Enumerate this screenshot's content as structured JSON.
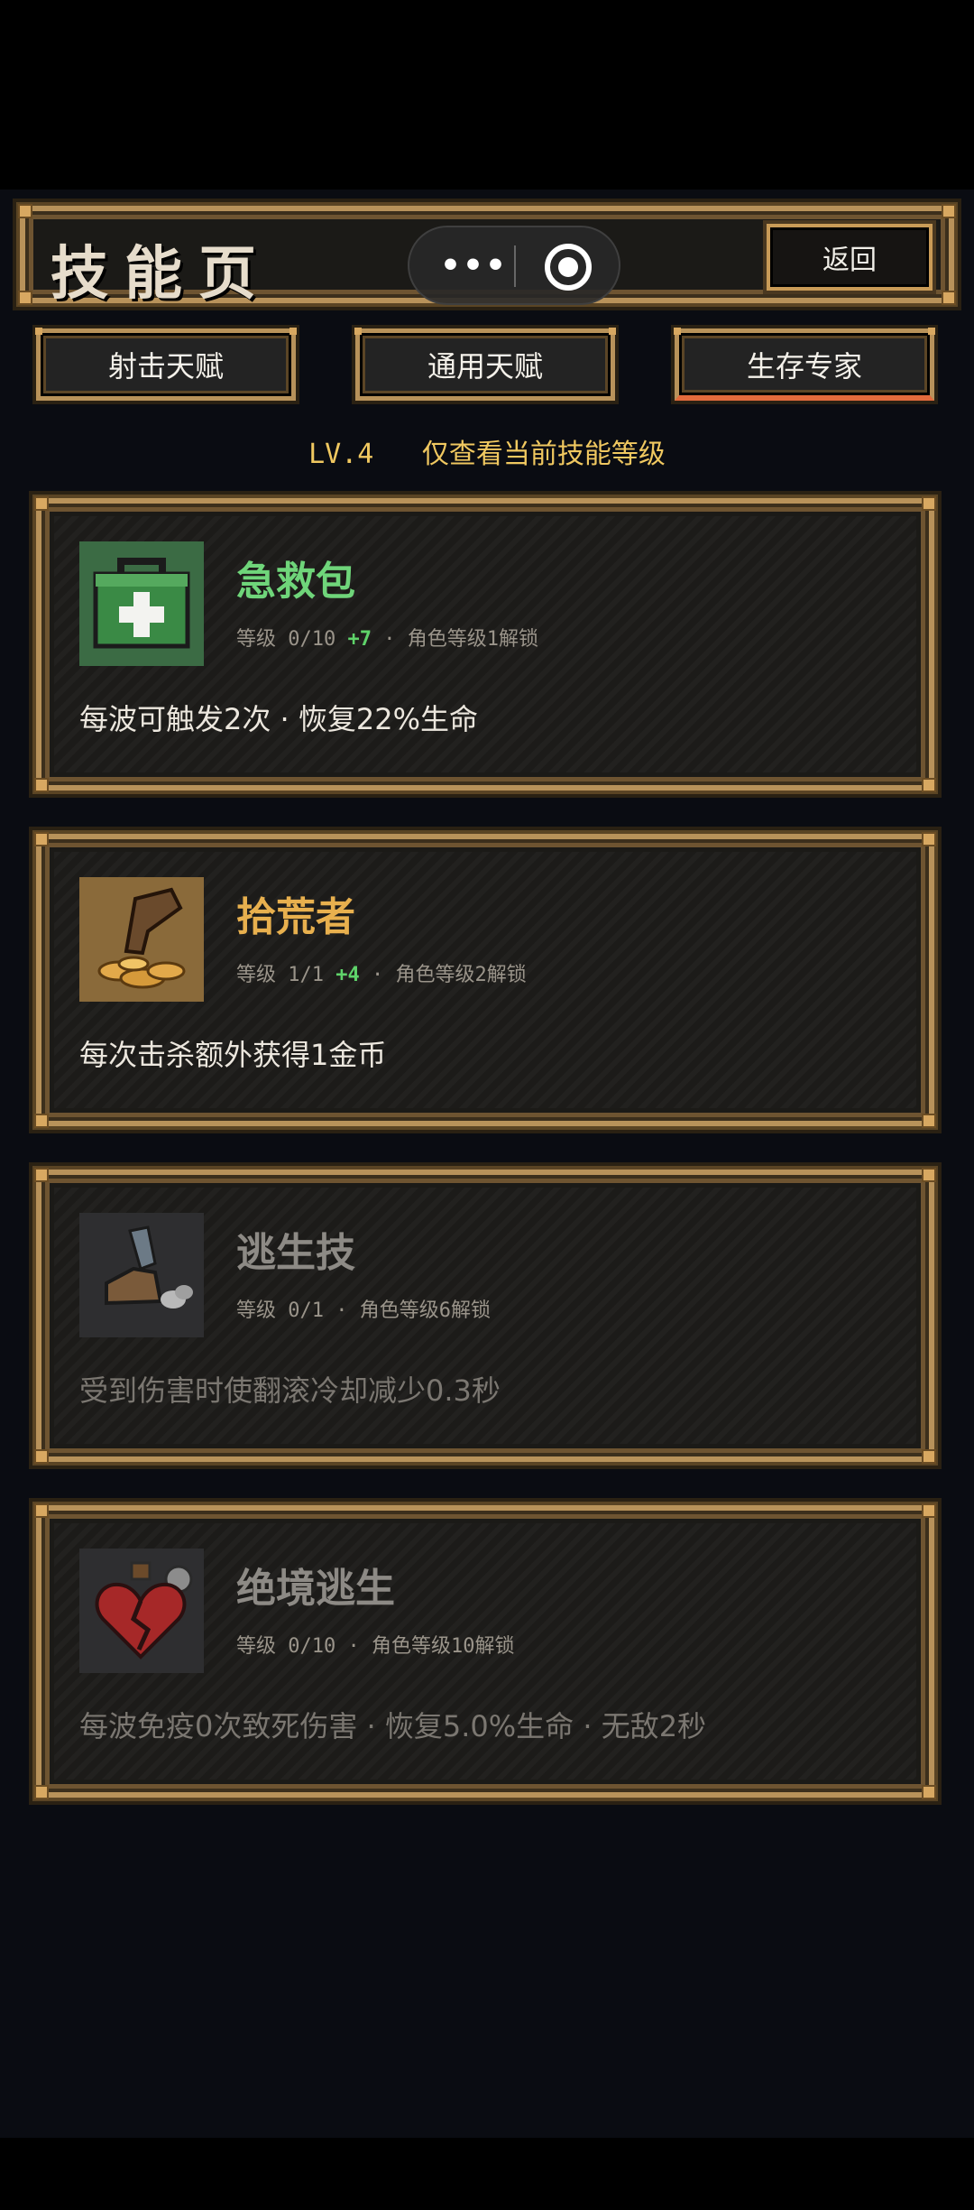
{
  "header": {
    "title": "技能页",
    "back_label": "返回"
  },
  "capsule": {
    "more_glyph": "•••",
    "close_glyph": "◉"
  },
  "tabs": [
    {
      "label": "射击天赋",
      "active": false
    },
    {
      "label": "通用天赋",
      "active": false
    },
    {
      "label": "生存专家",
      "active": true
    }
  ],
  "level": {
    "lv": "LV.4",
    "note": "仅查看当前技能等级"
  },
  "skills": [
    {
      "name": "急救包",
      "name_color": "#6fd57a",
      "level_text": "等级 0/10",
      "plus": "+7",
      "unlock": "· 角色等级1解锁",
      "desc": "每波可触发2次 · 恢复22%生命",
      "icon": "first-aid-kit-icon"
    },
    {
      "name": "拾荒者",
      "name_color": "#e8b04e",
      "level_text": "等级 1/1",
      "plus": "+4",
      "unlock": "· 角色等级2解锁",
      "desc": "每次击杀额外获得1金币",
      "icon": "coin-grab-icon"
    },
    {
      "name": "逃生技",
      "name_color": "#8d8a85",
      "level_text": "等级 0/1",
      "plus": "",
      "unlock": "· 角色等级6解锁",
      "desc": "受到伤害时使翻滚冷却减少0.3秒",
      "icon": "running-boot-icon"
    },
    {
      "name": "绝境逃生",
      "name_color": "#8d8a85",
      "level_text": "等级 0/10",
      "plus": "",
      "unlock": "· 角色等级10解锁",
      "desc": "每波免疫0次致死伤害 · 恢复5.0%生命 · 无敌2秒",
      "icon": "broken-heart-potion-icon"
    }
  ]
}
